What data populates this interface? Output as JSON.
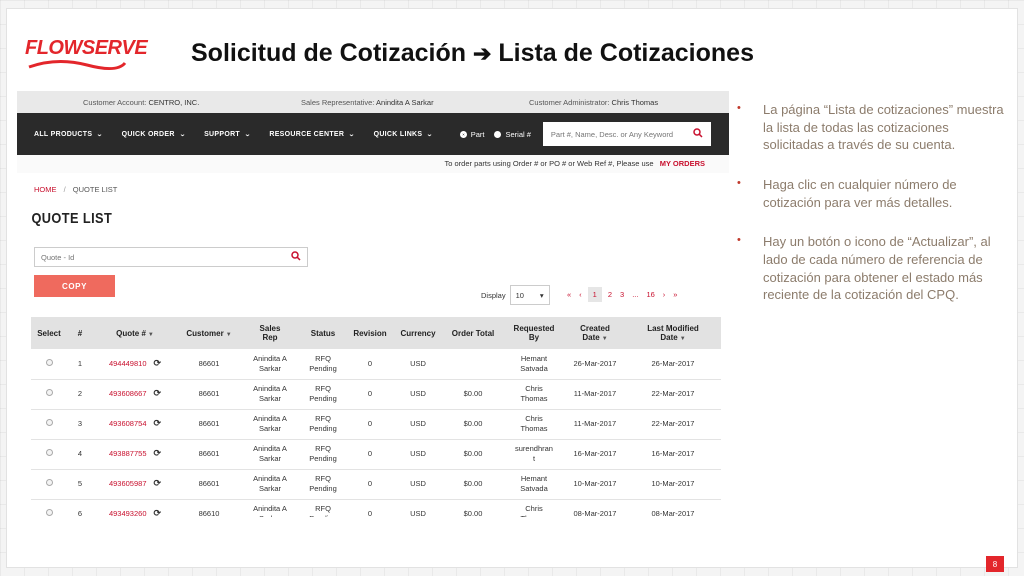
{
  "slide": {
    "title_part1": "Solicitud de Cotización",
    "title_arrow": "➔",
    "title_part2": "Lista de Cotizaciones",
    "logo_text": "FLOWSERVE",
    "page_number": "8"
  },
  "topbar": {
    "customer_account_label": "Customer Account:",
    "customer_account_value": "CENTRO, INC.",
    "sales_rep_label": "Sales Representative:",
    "sales_rep_value": "Anindita A Sarkar",
    "customer_admin_label": "Customer Administrator:",
    "customer_admin_value": "Chris Thomas"
  },
  "nav": {
    "items": [
      "ALL PRODUCTS",
      "QUICK ORDER",
      "SUPPORT",
      "RESOURCE CENTER",
      "QUICK LINKS"
    ],
    "radio_part": "Part",
    "radio_serial": "Serial #",
    "search_placeholder": "Part #, Name, Desc. or Any Keyword"
  },
  "order_note": {
    "text": "To order parts using Order # or PO # or Web Ref #, Please use",
    "link": "MY ORDERS"
  },
  "breadcrumb": {
    "home": "HOME",
    "separator": "/",
    "current": "QUOTE LIST"
  },
  "page_heading": "QUOTE LIST",
  "quote_search_placeholder": "Quote - Id",
  "copy_button": "COPY",
  "display": {
    "label": "Display",
    "value": "10"
  },
  "pager": {
    "first": "«",
    "prev": "‹",
    "pages": [
      "1",
      "2",
      "3"
    ],
    "ellipsis": "...",
    "last_page": "16",
    "next": "›",
    "last": "»"
  },
  "table": {
    "headers": {
      "select": "Select",
      "num": "#",
      "quote": "Quote #",
      "customer": "Customer",
      "sales_rep_1": "Sales",
      "sales_rep_2": "Rep",
      "status": "Status",
      "revision": "Revision",
      "currency": "Currency",
      "order_total": "Order Total",
      "requested_by_1": "Requested",
      "requested_by_2": "By",
      "created_1": "Created",
      "created_2": "Date",
      "modified_1": "Last Modified",
      "modified_2": "Date"
    },
    "rows": [
      {
        "num": "1",
        "quote": "494449810",
        "customer": "86601",
        "rep_1": "Anindita A",
        "rep_2": "Sarkar",
        "status_1": "RFQ",
        "status_2": "Pending",
        "revision": "0",
        "currency": "USD",
        "total": "",
        "req_1": "Hemant",
        "req_2": "Satvada",
        "created": "26-Mar-2017",
        "modified": "26-Mar-2017"
      },
      {
        "num": "2",
        "quote": "493608667",
        "customer": "86601",
        "rep_1": "Anindita A",
        "rep_2": "Sarkar",
        "status_1": "RFQ",
        "status_2": "Pending",
        "revision": "0",
        "currency": "USD",
        "total": "$0.00",
        "req_1": "Chris",
        "req_2": "Thomas",
        "created": "11-Mar-2017",
        "modified": "22-Mar-2017"
      },
      {
        "num": "3",
        "quote": "493608754",
        "customer": "86601",
        "rep_1": "Anindita A",
        "rep_2": "Sarkar",
        "status_1": "RFQ",
        "status_2": "Pending",
        "revision": "0",
        "currency": "USD",
        "total": "$0.00",
        "req_1": "Chris",
        "req_2": "Thomas",
        "created": "11-Mar-2017",
        "modified": "22-Mar-2017"
      },
      {
        "num": "4",
        "quote": "493887755",
        "customer": "86601",
        "rep_1": "Anindita A",
        "rep_2": "Sarkar",
        "status_1": "RFQ",
        "status_2": "Pending",
        "revision": "0",
        "currency": "USD",
        "total": "$0.00",
        "req_1": "surendhran",
        "req_2": "t",
        "created": "16-Mar-2017",
        "modified": "16-Mar-2017"
      },
      {
        "num": "5",
        "quote": "493605987",
        "customer": "86601",
        "rep_1": "Anindita A",
        "rep_2": "Sarkar",
        "status_1": "RFQ",
        "status_2": "Pending",
        "revision": "0",
        "currency": "USD",
        "total": "$0.00",
        "req_1": "Hemant",
        "req_2": "Satvada",
        "created": "10-Mar-2017",
        "modified": "10-Mar-2017"
      },
      {
        "num": "6",
        "quote": "493493260",
        "customer": "86610",
        "rep_1": "Anindita A",
        "rep_2": "Sarkar",
        "status_1": "RFQ",
        "status_2": "Pending",
        "revision": "0",
        "currency": "USD",
        "total": "$0.00",
        "req_1": "Chris",
        "req_2": "Thomas",
        "created": "08-Mar-2017",
        "modified": "08-Mar-2017"
      }
    ]
  },
  "bullets": [
    "La página “Lista de cotizaciones” muestra la lista de todas las cotizaciones solicitadas a través de su cuenta.",
    "Haga clic en cualquier número de cotización para ver más detalles.",
    "Hay un botón o icono de “Actualizar”,  al lado de cada número de referencia de cotización para obtener el estado más reciente de la cotización del CPQ."
  ],
  "colors": {
    "brand_red": "#e3262b",
    "link_red": "#c8102e",
    "nav_dark": "#2a2a2a",
    "copy_button": "#ef6a5e",
    "bullet_text": "#8c7c6c"
  },
  "icons": {
    "search": "search-icon",
    "refresh": "refresh-icon",
    "chevron": "chevron-down-icon",
    "sort": "sort-down-icon"
  }
}
